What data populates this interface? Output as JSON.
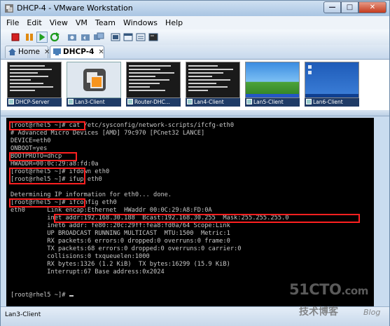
{
  "window": {
    "title": "DHCP-4 - VMware Workstation",
    "title_icon": "vmware-icon"
  },
  "menu": [
    "File",
    "Edit",
    "View",
    "VM",
    "Team",
    "Windows",
    "Help"
  ],
  "toolbar": [
    "power-off-icon",
    "suspend-icon",
    "power-on-icon",
    "reset-icon",
    "snapshot-icon",
    "revert-snapshot-icon",
    "snapshot-manager-icon",
    "full-screen-icon",
    "quick-switch-icon",
    "summary-view-icon",
    "console-view-icon"
  ],
  "tabs": [
    {
      "label": "Home",
      "icon": "home-icon",
      "active": false
    },
    {
      "label": "DHCP-4",
      "icon": "vm-icon",
      "active": true
    }
  ],
  "thumbnails": [
    {
      "label": "DHCP-Server",
      "screen": "console"
    },
    {
      "label": "Lan3-Client",
      "screen": "vmware-logo"
    },
    {
      "label": "Router-DHC...",
      "screen": "console"
    },
    {
      "label": "Lan4-Client",
      "screen": "console"
    },
    {
      "label": "Lan5-Client",
      "screen": "windows-desktop"
    },
    {
      "label": "Lan6-Client",
      "screen": "windows-blue"
    }
  ],
  "console_lines": [
    "[root@rhel5 ~]# cat /etc/sysconfig/network-scripts/ifcfg-eth0",
    "# Advanced Micro Devices [AMD] 79c970 [PCnet32 LANCE]",
    "DEVICE=eth0",
    "ONBOOT=yes",
    "BOOTPROTO=dhcp",
    "HWADDR=00:0c:29:a8:fd:0a",
    "[root@rhel5 ~]# ifdown eth0",
    "[root@rhel5 ~]# ifup eth0",
    "",
    "Determining IP information for eth0... done.",
    "[root@rhel5 ~]# ifconfig eth0",
    "eth0      Link encap:Ethernet  HWaddr 00:0C:29:A8:FD:0A",
    "          inet addr:192.168.30.188  Bcast:192.168.30.255  Mask:255.255.255.0",
    "          inet6 addr: fe80::20c:29ff:fea8:fd0a/64 Scope:Link",
    "          UP BROADCAST RUNNING MULTICAST  MTU:1500  Metric:1",
    "          RX packets:6 errors:0 dropped:0 overruns:0 frame:0",
    "          TX packets:68 errors:0 dropped:0 overruns:0 carrier:0",
    "          collisions:0 txqueuelen:1000",
    "          RX bytes:1326 (1.2 KiB)  TX bytes:16299 (15.9 KiB)",
    "          Interrupt:67 Base address:0x2024",
    "",
    "[root@rhel5 ~]# "
  ],
  "status": {
    "vm_label": "Lan3-Client"
  },
  "watermark": {
    "site": "51CTO",
    "domain": ".com",
    "subtitle": "技术博客",
    "blog": "Blog"
  },
  "colors": {
    "highlight": "#ff2020",
    "console_bg": "#000000",
    "console_fg": "#c8c8c8"
  }
}
